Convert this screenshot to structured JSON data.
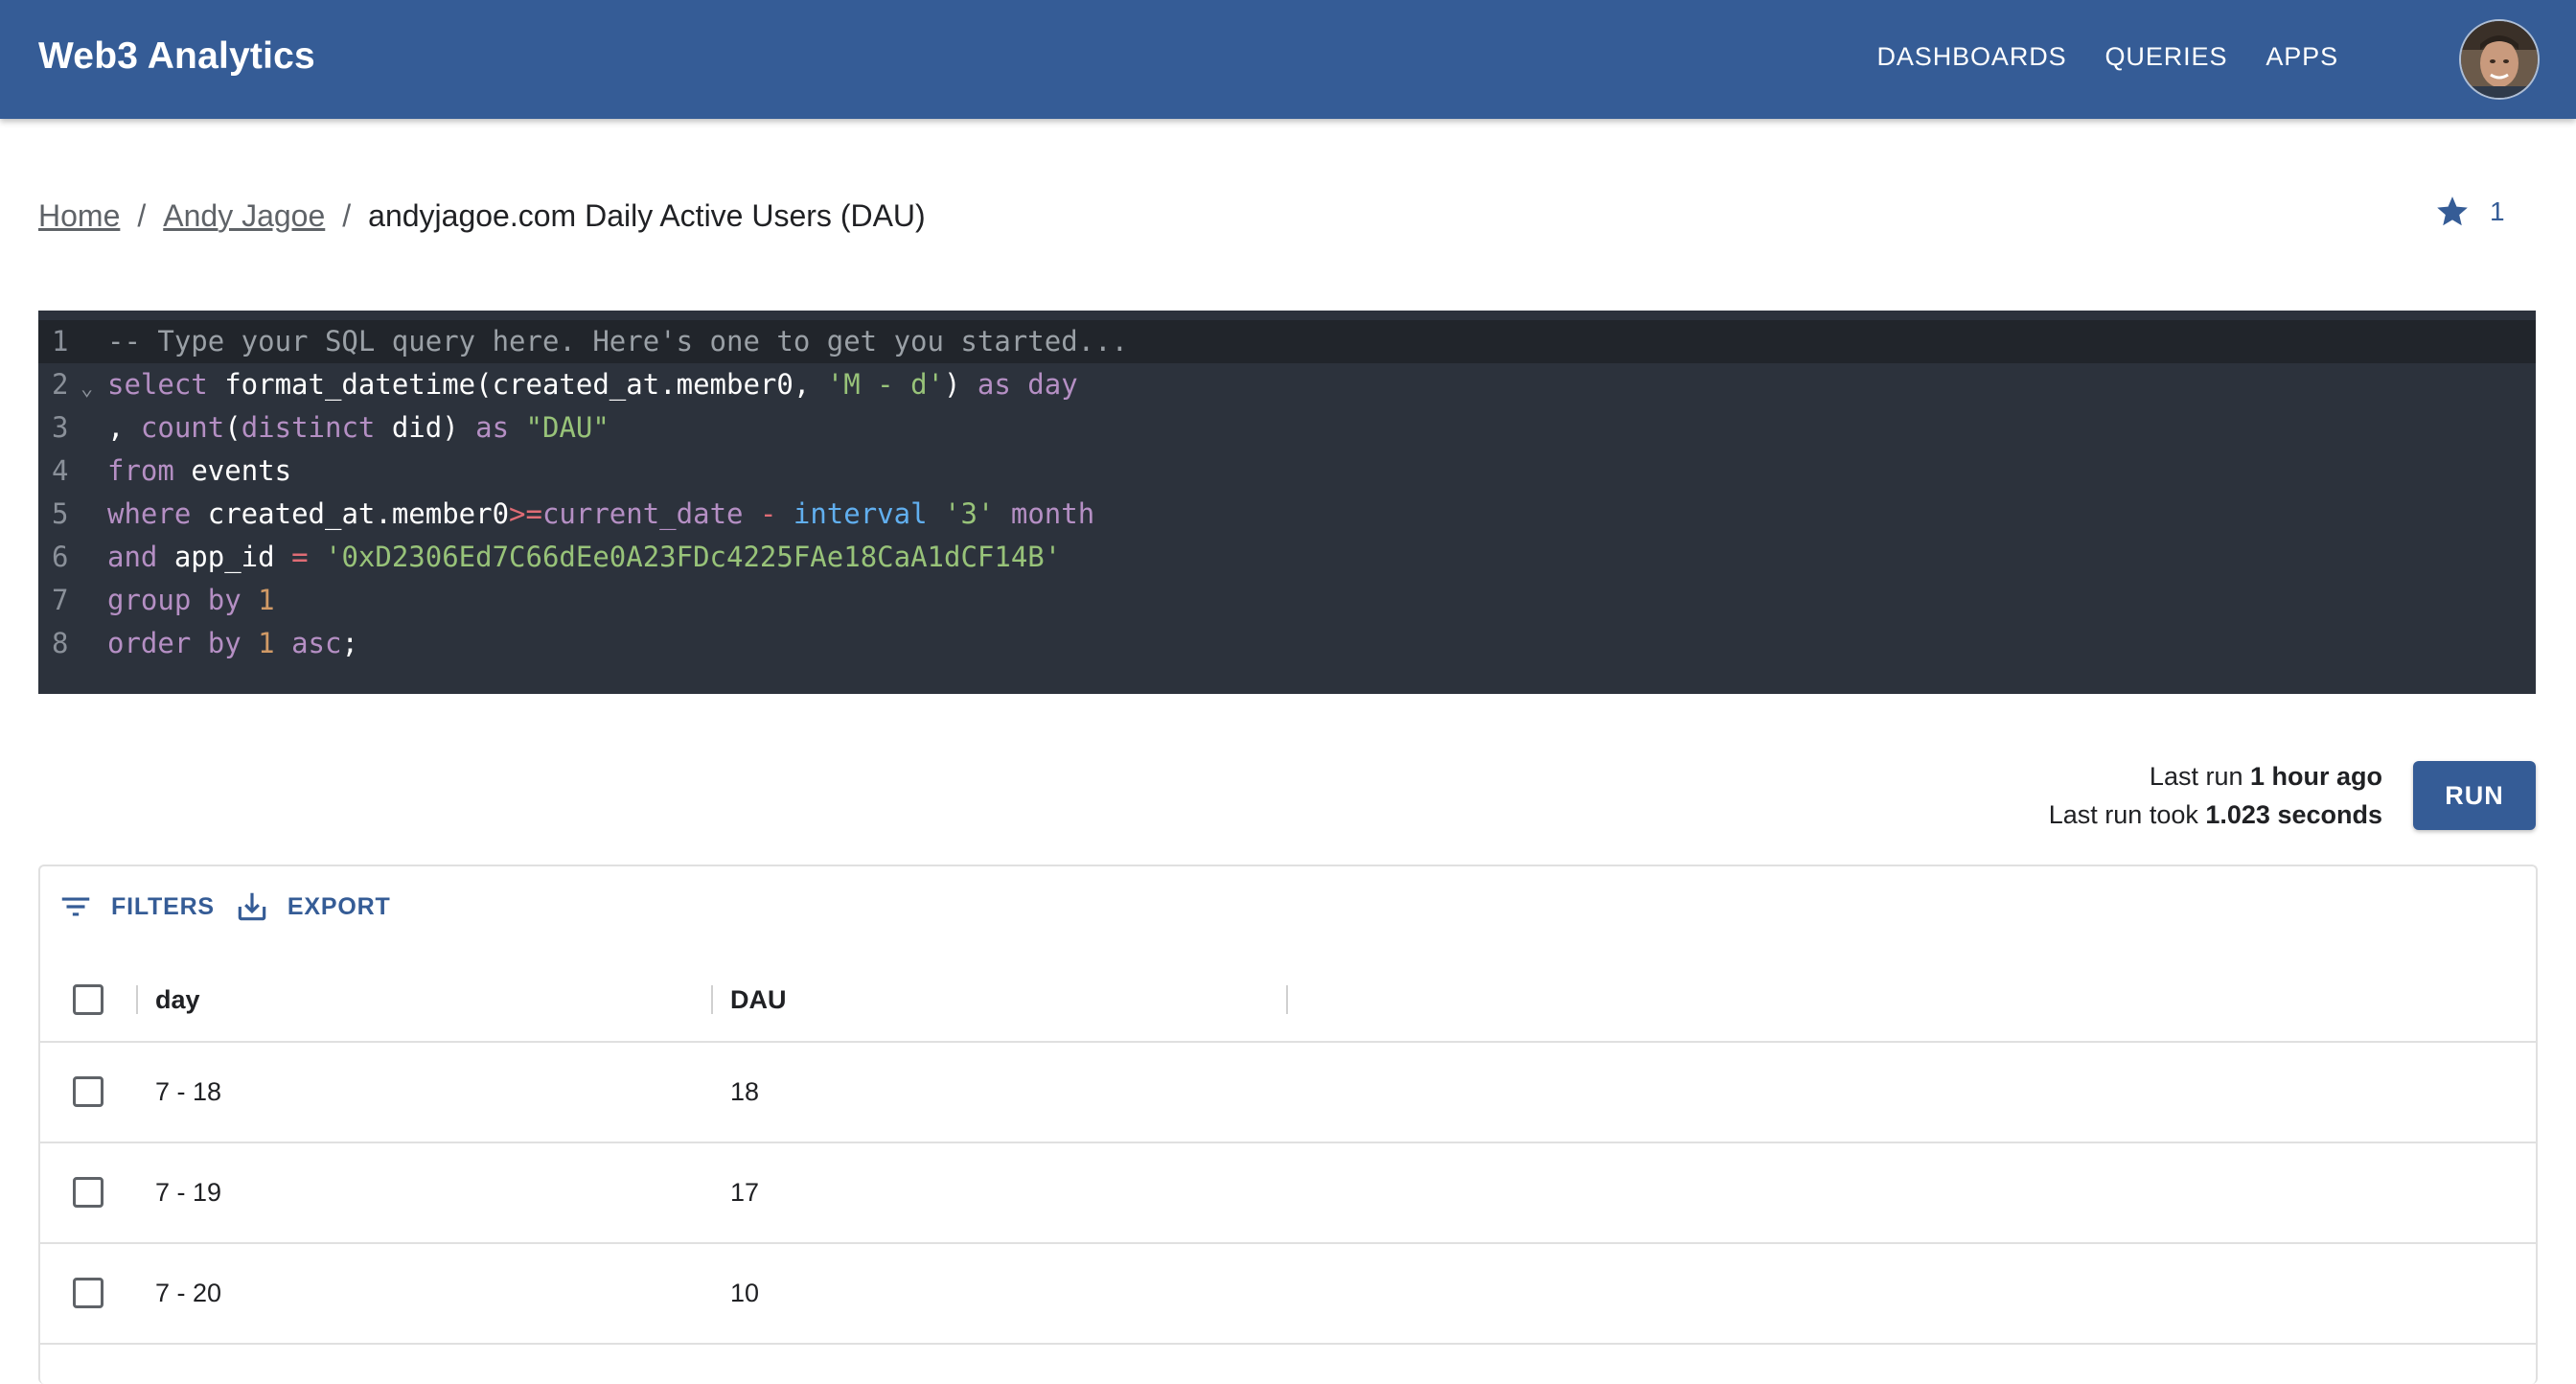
{
  "app": {
    "title": "Web3 Analytics",
    "nav": [
      "DASHBOARDS",
      "QUERIES",
      "APPS"
    ],
    "brand_color": "#355c96"
  },
  "breadcrumb": {
    "home": "Home",
    "user": "Andy Jagoe",
    "current": "andyjagoe.com Daily Active Users (DAU)"
  },
  "favorites": {
    "icon": "star-icon",
    "count": "1"
  },
  "editor": {
    "lines": [
      {
        "n": "1",
        "tokens": [
          [
            "comment",
            "-- Type your SQL query here. Here's one to get you started..."
          ]
        ]
      },
      {
        "n": "2",
        "tokens": [
          [
            "kw",
            "select "
          ],
          [
            "plain",
            "format_datetime(created_at.member0, "
          ],
          [
            "str",
            "'M - d'"
          ],
          [
            "plain",
            ") "
          ],
          [
            "kw",
            "as day"
          ]
        ]
      },
      {
        "n": "3",
        "tokens": [
          [
            "plain",
            ", "
          ],
          [
            "kw",
            "count"
          ],
          [
            "plain",
            "("
          ],
          [
            "kw",
            "distinct"
          ],
          [
            "plain",
            " did) "
          ],
          [
            "kw",
            "as "
          ],
          [
            "str",
            "\"DAU\""
          ]
        ]
      },
      {
        "n": "4",
        "tokens": [
          [
            "kw",
            "from "
          ],
          [
            "plain",
            "events"
          ]
        ]
      },
      {
        "n": "5",
        "tokens": [
          [
            "kw",
            "where "
          ],
          [
            "plain",
            "created_at.member0"
          ],
          [
            "op",
            ">="
          ],
          [
            "kw",
            "current_date "
          ],
          [
            "op",
            "- "
          ],
          [
            "fn",
            "interval "
          ],
          [
            "str",
            "'3' "
          ],
          [
            "kw",
            "month"
          ]
        ]
      },
      {
        "n": "6",
        "tokens": [
          [
            "kw",
            "and "
          ],
          [
            "plain",
            "app_id "
          ],
          [
            "op",
            "= "
          ],
          [
            "str",
            "'0xD2306Ed7C66dEe0A23FDc4225FAe18CaA1dCF14B'"
          ]
        ]
      },
      {
        "n": "7",
        "tokens": [
          [
            "kw",
            "group by "
          ],
          [
            "num",
            "1"
          ]
        ]
      },
      {
        "n": "8",
        "tokens": [
          [
            "kw",
            "order by "
          ],
          [
            "num",
            "1 "
          ],
          [
            "kw",
            "asc"
          ],
          [
            "plain",
            ";"
          ]
        ]
      }
    ]
  },
  "run": {
    "last_run_label": "Last run ",
    "last_run_value": "1 hour ago",
    "took_label": "Last run took ",
    "took_value": "1.023 seconds",
    "button": "RUN"
  },
  "grid": {
    "toolbar": {
      "filters": "FILTERS",
      "export": "EXPORT"
    },
    "columns": [
      "day",
      "DAU"
    ],
    "rows": [
      [
        "7 - 18",
        "18"
      ],
      [
        "7 - 19",
        "17"
      ],
      [
        "7 - 20",
        "10"
      ]
    ]
  }
}
